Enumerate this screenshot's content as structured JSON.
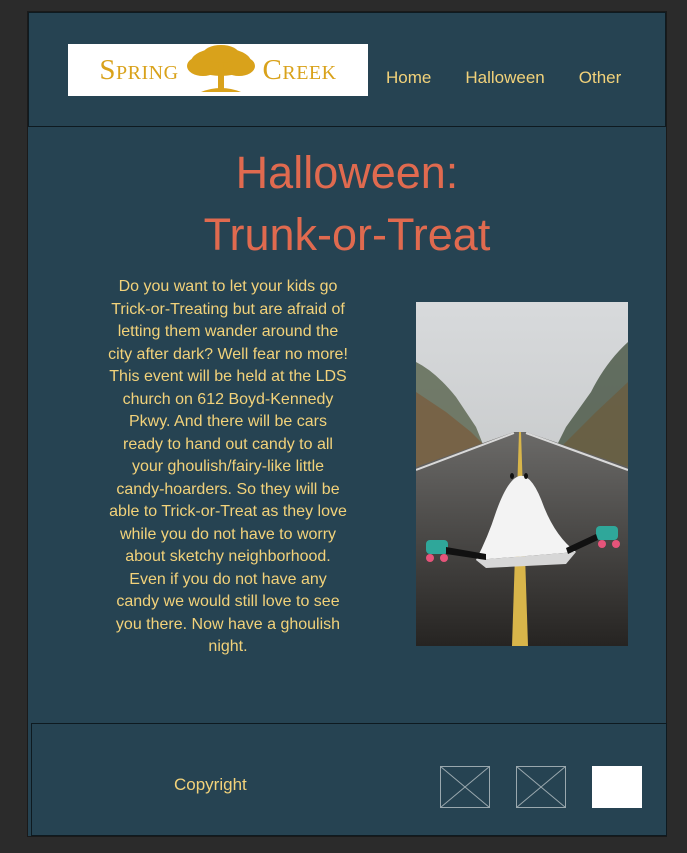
{
  "header": {
    "logo": {
      "word_left": "Spring",
      "word_right": "Creek"
    },
    "nav": [
      "Home",
      "Halloween",
      "Other"
    ]
  },
  "main": {
    "title_line1": "Halloween:",
    "title_line2": "Trunk-or-Treat",
    "body": "Do you want to let your kids go Trick-or-Treating but are afraid of letting them wander around the city after dark? Well fear no more! This event will be held at the LDS church on 612 Boyd-Kennedy Pkwy. And there will be cars ready to hand out candy to all your ghoulish/fairy-like little candy-hoarders. So they will be able to Trick-or-Treat as they love while you do not have to worry about sketchy neighborhood. Even if you do not have any candy we would still love to see you there. Now have a ghoulish night."
  },
  "footer": {
    "copyright": "Copyright"
  },
  "colors": {
    "background": "#264352",
    "accent": "#e06a4f",
    "text": "#f2d27a",
    "logo_gold": "#d9a21b"
  },
  "icons": [
    "tree-logo-icon",
    "image-placeholder-icon",
    "image-placeholder-icon",
    "blank-icon"
  ]
}
